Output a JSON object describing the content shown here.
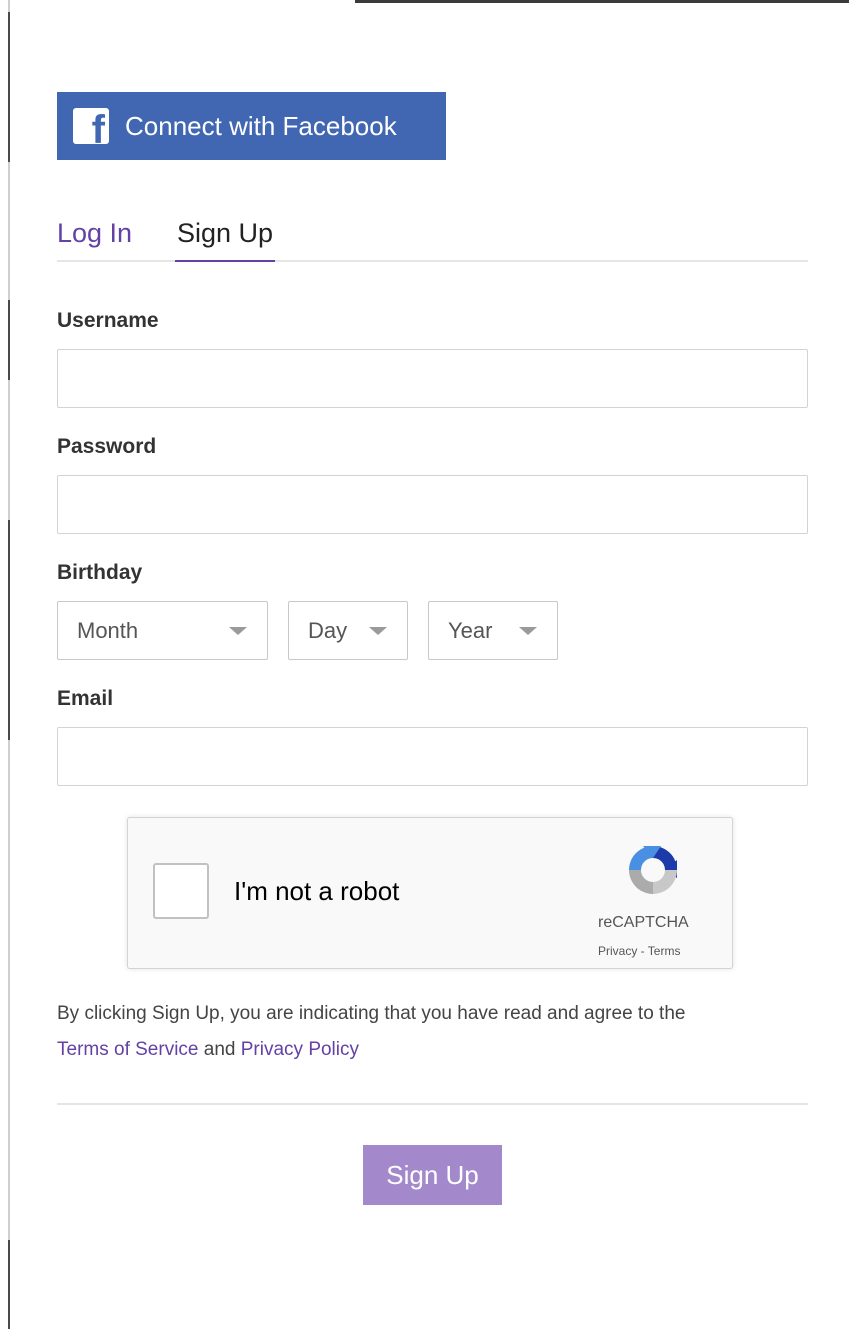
{
  "facebook": {
    "label": "Connect with Facebook",
    "icon": "facebook-icon",
    "color": "#4267b2"
  },
  "tabs": [
    {
      "label": "Log In",
      "active": false
    },
    {
      "label": "Sign Up",
      "active": true
    }
  ],
  "form": {
    "username_label": "Username",
    "username_value": "",
    "password_label": "Password",
    "password_value": "",
    "birthday_label": "Birthday",
    "month": "Month",
    "day": "Day",
    "year": "Year",
    "email_label": "Email",
    "email_value": ""
  },
  "recaptcha": {
    "label": "I'm not a robot",
    "brand": "reCAPTCHA",
    "privacy": "Privacy",
    "separator": " - ",
    "terms": "Terms",
    "checked": false
  },
  "legal": {
    "text_before": "By clicking Sign Up, you are indicating that you have read and agree to the",
    "tos": "Terms of Service",
    "and": " and ",
    "privacy": "Privacy Policy"
  },
  "signup_button": {
    "label": "Sign Up",
    "color": "#a389cc"
  },
  "colors": {
    "accent": "#6441a4"
  }
}
